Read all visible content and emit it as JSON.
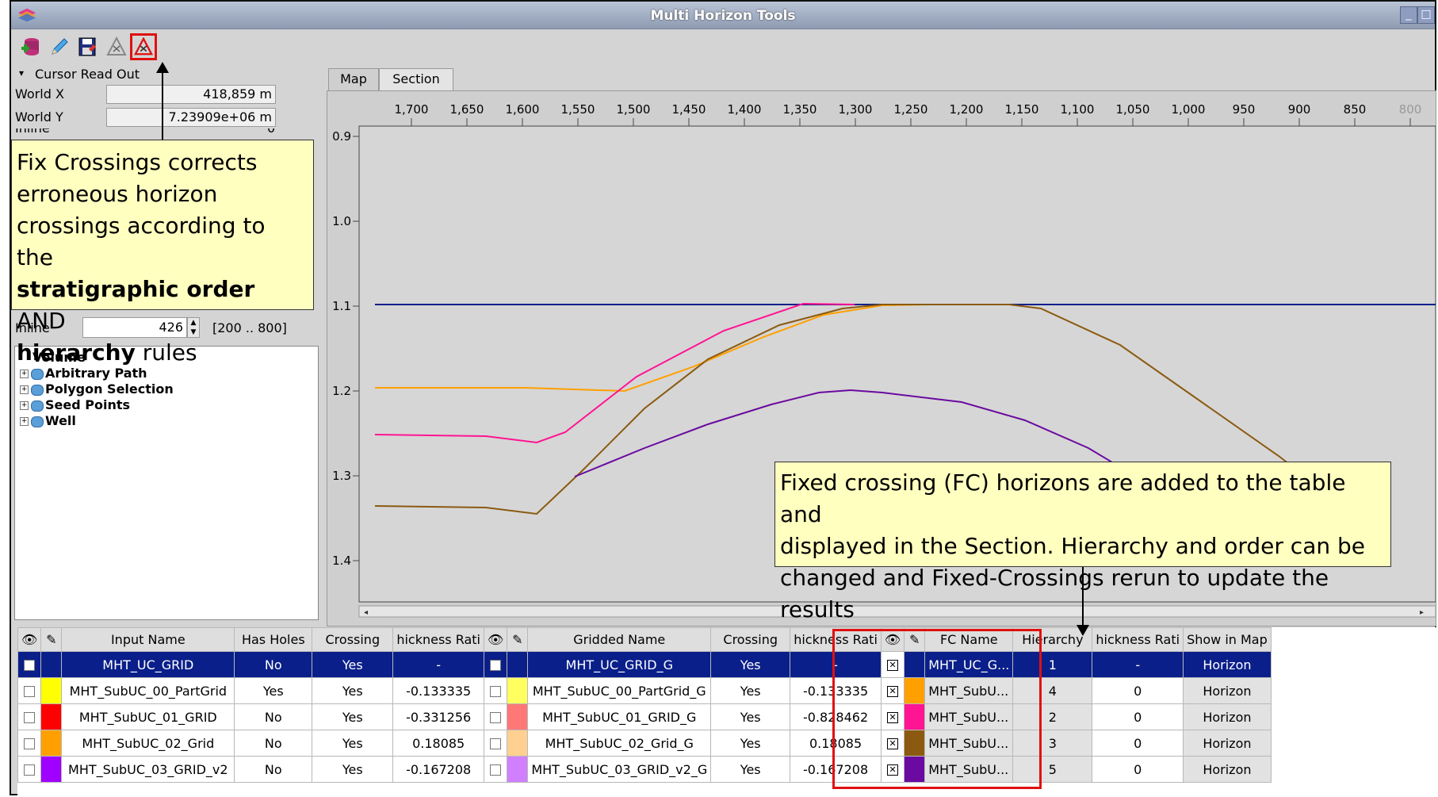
{
  "window": {
    "title": "Multi Horizon Tools"
  },
  "toolbar": {
    "icons": [
      "database-add-icon",
      "pencil-icon",
      "save-icon",
      "crossing-warning-icon",
      "fix-crossings-icon"
    ]
  },
  "cursor_readout": {
    "header": "Cursor Read Out",
    "world_x_label": "World X",
    "world_x_value": "418,859 m",
    "world_y_label": "World Y",
    "world_y_value": "7.23909e+06 m",
    "inline_label_partial": "Inline",
    "inline_value_partial": "0"
  },
  "inline_control": {
    "label": "Inline",
    "value": "426",
    "range": "[200 .. 800]"
  },
  "tree": {
    "root": "Volume",
    "items": [
      "Arbitrary Path",
      "Polygon Selection",
      "Seed Points",
      "Well"
    ]
  },
  "tabs": [
    {
      "label": "Map",
      "selected": false
    },
    {
      "label": "Section",
      "selected": true
    }
  ],
  "section": {
    "x_ticks": [
      "1,700",
      "1,650",
      "1,600",
      "1,550",
      "1,500",
      "1,450",
      "1,400",
      "1,350",
      "1,300",
      "1,250",
      "1,200",
      "1,150",
      "1,100",
      "1,050",
      "1,000",
      "950",
      "900",
      "850",
      "800"
    ],
    "y_ticks": [
      "0.9",
      "1.0",
      "1.1",
      "1.2",
      "1.3",
      "1.4"
    ]
  },
  "callouts": {
    "fix_crossings": {
      "line1": "Fix Crossings corrects",
      "line2": "erroneous horizon",
      "line3": "crossings according to the",
      "bold1": "stratigraphic order",
      "mid": " AND",
      "bold2": "hierarchy",
      "tail": " rules"
    },
    "fixed_crossing": {
      "line1": "Fixed crossing (FC) horizons are added to the table and",
      "line2": "displayed in the Section. Hierarchy and order can be",
      "line3": "changed and Fixed-Crossings rerun to update the results"
    }
  },
  "table": {
    "headers": [
      "Input Name",
      "Has Holes",
      "Crossing",
      "hickness Rati",
      "Gridded Name",
      "Crossing",
      "hickness Rati",
      "FC Name",
      "Hierarchy",
      "hickness Rati",
      "Show in Map"
    ],
    "rows": [
      {
        "input_color": "#0a1f8a",
        "input_name": "MHT_UC_GRID",
        "has_holes": "No",
        "crossing": "Yes",
        "thick1": "-",
        "grid_color": "#0a1f8a",
        "gridded_name": "MHT_UC_GRID_G",
        "crossing2": "Yes",
        "thick2": "-",
        "fc_color": "#0a1f8a",
        "fc_name": "MHT_UC_G...",
        "hierarchy": "1",
        "thick3": "-",
        "show": "Horizon"
      },
      {
        "input_color": "#ffff00",
        "input_name": "MHT_SubUC_00_PartGrid",
        "has_holes": "Yes",
        "crossing": "Yes",
        "thick1": "-0.133335",
        "grid_color": "#ffff60",
        "gridded_name": "MHT_SubUC_00_PartGrid_G",
        "crossing2": "Yes",
        "thick2": "-0.133335",
        "fc_color": "#ffa000",
        "fc_name": "MHT_SubU...",
        "hierarchy": "4",
        "thick3": "0",
        "show": "Horizon"
      },
      {
        "input_color": "#ff0000",
        "input_name": "MHT_SubUC_01_GRID",
        "has_holes": "No",
        "crossing": "Yes",
        "thick1": "-0.331256",
        "grid_color": "#ff7878",
        "gridded_name": "MHT_SubUC_01_GRID_G",
        "crossing2": "Yes",
        "thick2": "-0.828462",
        "fc_color": "#ff1493",
        "fc_name": "MHT_SubU...",
        "hierarchy": "2",
        "thick3": "0",
        "show": "Horizon"
      },
      {
        "input_color": "#ffa000",
        "input_name": "MHT_SubUC_02_Grid",
        "has_holes": "No",
        "crossing": "Yes",
        "thick1": "0.18085",
        "grid_color": "#ffd090",
        "gridded_name": "MHT_SubUC_02_Grid_G",
        "crossing2": "Yes",
        "thick2": "0.18085",
        "fc_color": "#8b5a10",
        "fc_name": "MHT_SubU...",
        "hierarchy": "3",
        "thick3": "0",
        "show": "Horizon"
      },
      {
        "input_color": "#a000ff",
        "input_name": "MHT_SubUC_03_GRID_v2",
        "has_holes": "No",
        "crossing": "Yes",
        "thick1": "-0.167208",
        "grid_color": "#d080ff",
        "gridded_name": "MHT_SubUC_03_GRID_v2_G",
        "crossing2": "Yes",
        "thick2": "-0.167208",
        "fc_color": "#6a0aa0",
        "fc_name": "MHT_SubU...",
        "hierarchy": "5",
        "thick3": "0",
        "show": "Horizon"
      }
    ]
  }
}
